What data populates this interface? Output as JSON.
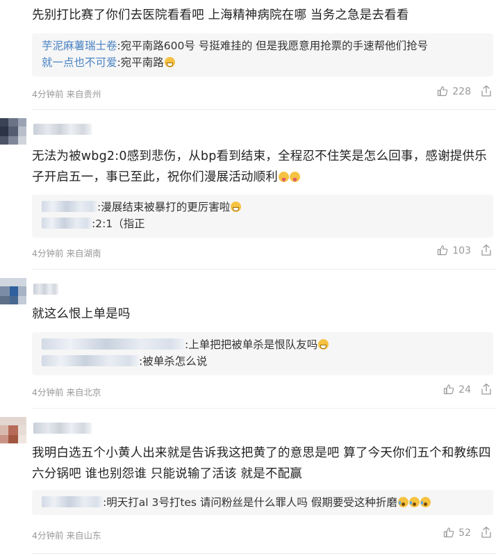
{
  "comments": [
    {
      "text": "先别打比赛了你们去医院看看吧 上海精神病院在哪 当务之急是去看看",
      "replies": [
        {
          "name": "芋泥麻薯瑞士卷",
          "text": ":宛平南路600号 号挺难挂的 但是我愿意用抢票的手速帮他们抢号"
        },
        {
          "name": "就一点也不可爱",
          "text": ":宛平南路"
        }
      ],
      "time": "4分钟前",
      "location": "来自贵州",
      "likes": "228"
    },
    {
      "text": "无法为被wbg2:0感到悲伤，从bp看到结束，全程忍不住笑是怎么回事，感谢提供乐子开启五一，事已至此，祝你们漫展活动顺利",
      "replies": [
        {
          "text": ":漫展结束被暴打的更厉害啦"
        },
        {
          "text": ":2:1（指正"
        }
      ],
      "time": "4分钟前",
      "location": "来自湖南",
      "likes": "103"
    },
    {
      "text": "就这么恨上单是吗",
      "replies": [
        {
          "text": ":上单把把被单杀是恨队友吗"
        },
        {
          "text": ":被单杀怎么说"
        }
      ],
      "time": "4分钟前",
      "location": "来自北京",
      "likes": "24"
    },
    {
      "text": "我明白选五个小黄人出来就是告诉我这把黄了的意思是吧 算了今天你们五个和教练四六分锅吧 谁也别怨谁 只能说输了活该 就是不配赢",
      "replies": [
        {
          "text": ":明天打al 3号打tes 请问粉丝是什么罪人吗 假期要受这种折磨"
        }
      ],
      "time": "4分钟前",
      "location": "来自山东",
      "likes": "52"
    }
  ],
  "icons": {
    "like": "thumbs-up-icon",
    "share": "share-icon",
    "emoji": "emoji-icon"
  },
  "colors": {
    "reply_name": "#4a83c3",
    "meta": "#999999",
    "reply_bg": "#f6f6f6"
  }
}
